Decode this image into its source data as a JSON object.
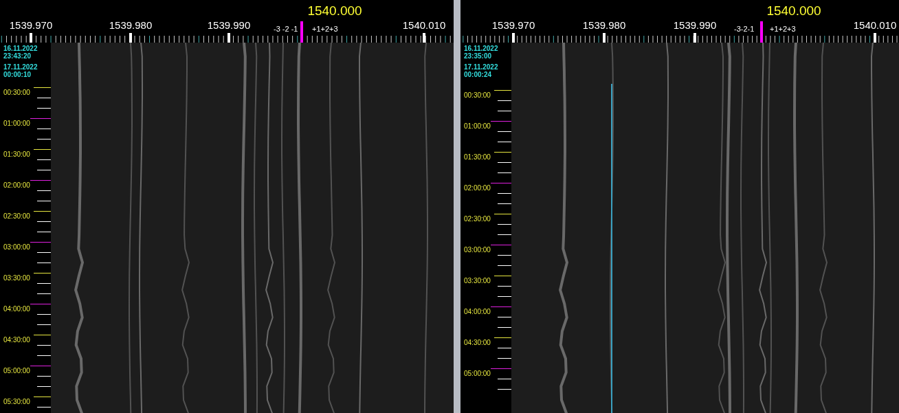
{
  "panels": [
    {
      "center_frequency": "1540.000",
      "frequency_labels": [
        "1539.970",
        "1539.980",
        "1539.990",
        "1540.010"
      ],
      "offset_labels": [
        "-3 -2 -1",
        "+1+2+3"
      ],
      "timestamps": [
        {
          "date": "16.11.2022",
          "time": "23:43:20"
        },
        {
          "date": "17.11.2022",
          "time": "00:00:10"
        }
      ],
      "time_labels": [
        "00:30:00",
        "01:00:00",
        "01:30:00",
        "02:00:00",
        "02:30:00",
        "03:00:00",
        "03:30:00",
        "04:00:00",
        "04:30:00",
        "05:00:00",
        "05:30:00"
      ]
    },
    {
      "center_frequency": "1540.000",
      "frequency_labels": [
        "1539.970",
        "1539.980",
        "1539.990",
        "1540.010"
      ],
      "offset_labels": [
        "-3-2-1",
        "+1+2+3"
      ],
      "timestamps": [
        {
          "date": "16.11.2022",
          "time": "23:35:00"
        },
        {
          "date": "17.11.2022",
          "time": "00:00:24"
        }
      ],
      "time_labels": [
        "00:30:00",
        "01:00:00",
        "01:30:00",
        "02:00:00",
        "02:30:00",
        "03:00:00",
        "03:30:00",
        "04:00:00",
        "04:30:00",
        "05:00:00"
      ]
    }
  ]
}
